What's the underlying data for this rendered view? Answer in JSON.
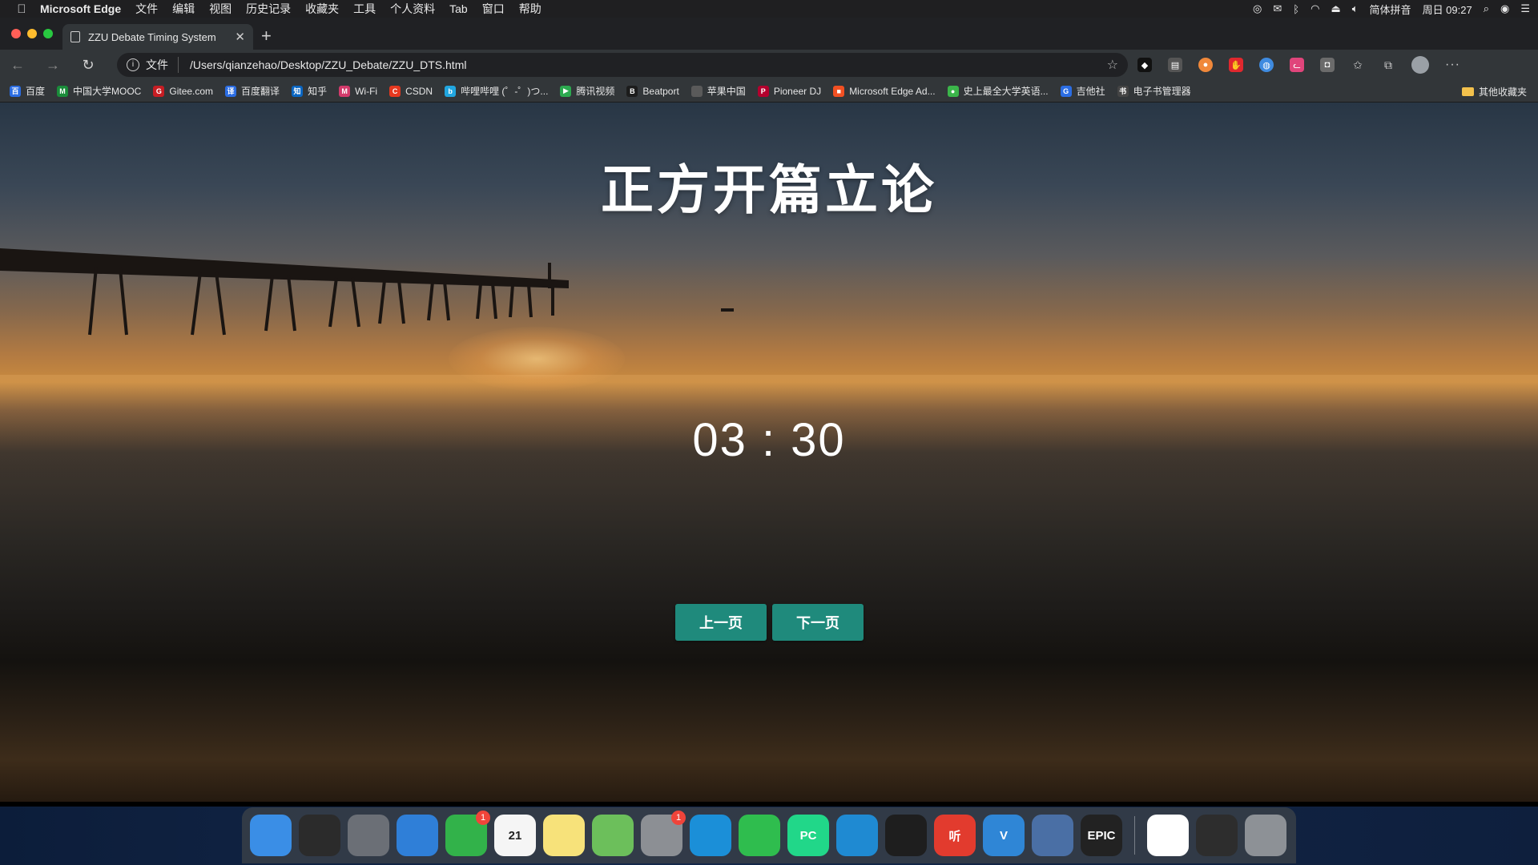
{
  "menubar": {
    "app_name": "Microsoft Edge",
    "items": [
      "文件",
      "编辑",
      "视图",
      "历史记录",
      "收藏夹",
      "工具",
      "个人资料",
      "Tab",
      "窗口",
      "帮助"
    ],
    "input_method": "简体拼音",
    "clock": "周日 09:27"
  },
  "browser": {
    "tab_title": "ZZU Debate Timing System",
    "address_scheme": "文件",
    "address_path": "/Users/qianzehao/Desktop/ZZU_Debate/ZZU_DTS.html",
    "bookmarks": [
      {
        "label": "百度",
        "color": "#2b6de3",
        "glyph": "百"
      },
      {
        "label": "中国大学MOOC",
        "color": "#1a8c3a",
        "glyph": "M"
      },
      {
        "label": "Gitee.com",
        "color": "#c71d23",
        "glyph": "G"
      },
      {
        "label": "百度翻译",
        "color": "#2b6de3",
        "glyph": "译"
      },
      {
        "label": "知乎",
        "color": "#0a66c2",
        "glyph": "知"
      },
      {
        "label": "Wi-Fi",
        "color": "#d33a6b",
        "glyph": "M"
      },
      {
        "label": "CSDN",
        "color": "#e6381f",
        "glyph": "C"
      },
      {
        "label": "哔哩哔哩 (゜-゜)つ...",
        "color": "#21a6e0",
        "glyph": "b"
      },
      {
        "label": "腾讯视频",
        "color": "#2ca94f",
        "glyph": "▶"
      },
      {
        "label": "Beatport",
        "color": "#1c1c1c",
        "glyph": "B"
      },
      {
        "label": "苹果中国",
        "color": "#5a5a5a",
        "glyph": ""
      },
      {
        "label": "Pioneer DJ",
        "color": "#b3002d",
        "glyph": "P"
      },
      {
        "label": "Microsoft Edge Ad...",
        "color": "#f25022",
        "glyph": "■"
      },
      {
        "label": "史上最全大学英语...",
        "color": "#3bb54a",
        "glyph": "●"
      },
      {
        "label": "吉他社",
        "color": "#2b6de3",
        "glyph": "G"
      },
      {
        "label": "电子书管理器",
        "color": "#444444",
        "glyph": "书"
      }
    ],
    "other_bookmarks": "其他收藏夹"
  },
  "page": {
    "title": "正方开篇立论",
    "timer": "03 : 30",
    "prev_button": "上一页",
    "next_button": "下一页",
    "button_color": "#1f8a7c"
  },
  "dock": {
    "apps": [
      {
        "name": "Finder",
        "color": "#3a8ee6",
        "label": ""
      },
      {
        "name": "Dashboard",
        "color": "#2b2b2b",
        "label": ""
      },
      {
        "name": "Launchpad",
        "color": "#6b6f76",
        "label": ""
      },
      {
        "name": "Safari",
        "color": "#2f7fd8",
        "label": ""
      },
      {
        "name": "FaceTime",
        "color": "#32b24a",
        "label": "",
        "badge": "1"
      },
      {
        "name": "Calendar",
        "color": "#f5f5f5",
        "label": "21"
      },
      {
        "name": "Notes",
        "color": "#f7e27a",
        "label": ""
      },
      {
        "name": "Maps",
        "color": "#6cbf5b",
        "label": ""
      },
      {
        "name": "System Preferences",
        "color": "#8c8f94",
        "label": "",
        "badge": "1"
      },
      {
        "name": "Microsoft Edge",
        "color": "#1b8fd8",
        "label": ""
      },
      {
        "name": "WeChat",
        "color": "#2fbd4e",
        "label": ""
      },
      {
        "name": "PyCharm",
        "color": "#21d789",
        "label": "PC"
      },
      {
        "name": "VS Code",
        "color": "#1f8ad2",
        "label": ""
      },
      {
        "name": "Terminal",
        "color": "#1e1e1e",
        "label": ""
      },
      {
        "name": "NetEase Music",
        "color": "#e23b2e",
        "label": "听"
      },
      {
        "name": "Visual Paradigm",
        "color": "#2f86d6",
        "label": "V"
      },
      {
        "name": "VirtualBox",
        "color": "#4a6fa5",
        "label": ""
      },
      {
        "name": "Epic Games",
        "color": "#222222",
        "label": "EPIC"
      },
      {
        "name": "Edge Document",
        "color": "#ffffff",
        "label": ""
      },
      {
        "name": "VS Code Window",
        "color": "#2d2d2d",
        "label": ""
      },
      {
        "name": "Trash",
        "color": "#8d9196",
        "label": ""
      }
    ]
  }
}
